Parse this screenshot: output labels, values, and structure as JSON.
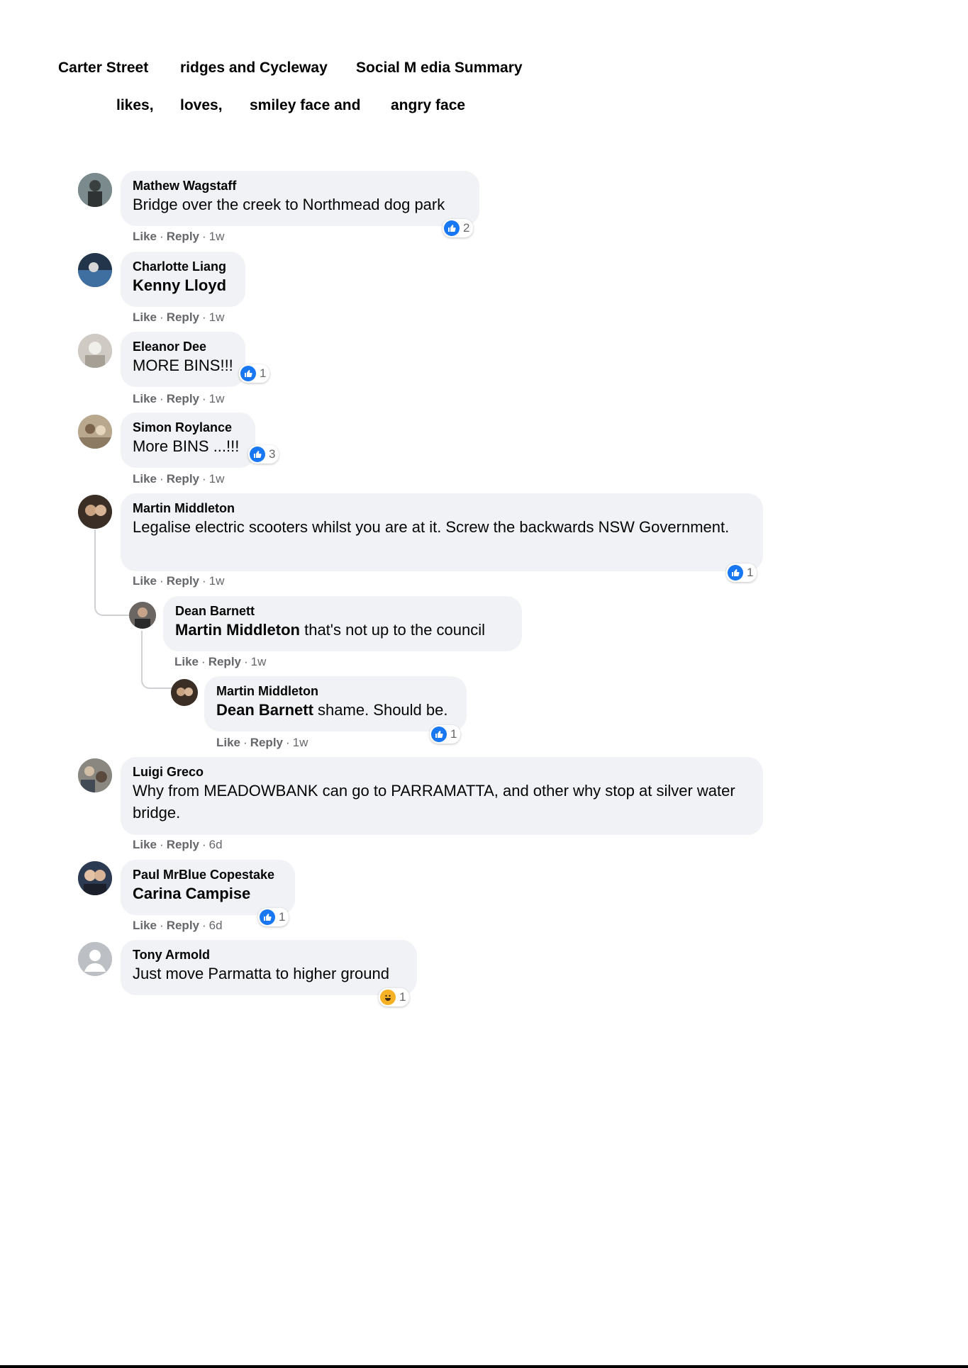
{
  "header": {
    "title_part1": "Carter Street",
    "title_part2": "ridges and Cycleway",
    "title_part3": "Social M edia Summary",
    "legend": [
      "likes,",
      "loves,",
      "smiley face and",
      "angry face"
    ]
  },
  "colors": {
    "bubble": "#f0f2f5",
    "like": "#1877f2",
    "haha": "#f7b125",
    "meta_text": "#65676b"
  },
  "actions": {
    "like": "Like",
    "reply": "Reply",
    "separator": "·"
  },
  "comments": [
    {
      "author": "Mathew Wagstaff",
      "text": "Bridge over the creek to Northmead dog park",
      "time": "1w",
      "reaction_icon": "like-icon",
      "reaction_count": "2"
    },
    {
      "author": "Charlotte Liang",
      "mention": "Kenny Lloyd",
      "time": "1w"
    },
    {
      "author": "Eleanor Dee",
      "text": "MORE BINS!!!",
      "time": "1w",
      "reaction_icon": "like-icon",
      "reaction_count": "1"
    },
    {
      "author": "Simon Roylance",
      "text": "More BINS ...!!!",
      "time": "1w",
      "reaction_icon": "like-icon",
      "reaction_count": "3"
    },
    {
      "author": "Martin Middleton",
      "text": "Legalise electric scooters whilst you are at it. Screw the backwards NSW Government.",
      "time": "1w",
      "reaction_icon": "like-icon",
      "reaction_count": "1"
    },
    {
      "author": "Dean Barnett",
      "mention": "Martin Middleton",
      "text": " that's not up to the council",
      "time": "1w"
    },
    {
      "author": "Martin Middleton",
      "mention": "Dean Barnett",
      "text": " shame. Should be.",
      "time": "1w",
      "reaction_icon": "like-icon",
      "reaction_count": "1"
    },
    {
      "author": "Luigi Greco",
      "text": "Why from MEADOWBANK can go to PARRAMATTA, and other why stop at silver water bridge.",
      "time": "6d"
    },
    {
      "author": "Paul MrBlue Copestake",
      "mention": "Carina Campise",
      "time": "6d",
      "reaction_icon": "like-icon",
      "reaction_count": "1"
    },
    {
      "author": "Tony Armold",
      "text": "Just move Parmatta to higher ground",
      "reaction_icon": "haha-icon",
      "reaction_count": "1"
    }
  ]
}
